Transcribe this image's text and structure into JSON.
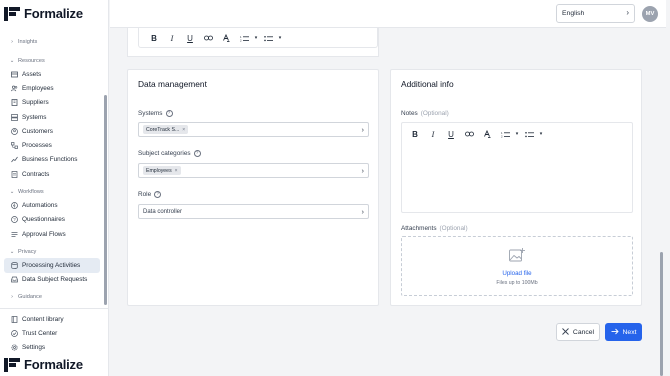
{
  "app": {
    "brand": "Formalize"
  },
  "sidebar": {
    "groups": {
      "insights": "Insights",
      "resources": "Resources",
      "workflows": "Workflows",
      "privacy": "Privacy",
      "guidance": "Guidance"
    },
    "resources": [
      "Assets",
      "Employees",
      "Suppliers",
      "Systems",
      "Customers",
      "Processes",
      "Business Functions",
      "Contracts"
    ],
    "workflows": [
      "Automations",
      "Questionnaires",
      "Approval Flows"
    ],
    "privacy": [
      "Processing Activities",
      "Data Subject Requests"
    ],
    "bottom": [
      "Content library",
      "Trust Center",
      "Settings"
    ],
    "active_item": "Processing Activities"
  },
  "header": {
    "language": "English",
    "avatar_initials": "MV"
  },
  "data_management": {
    "title": "Data management",
    "systems_label": "Systems",
    "systems_chip": "CoreTrack S...",
    "subject_categories_label": "Subject categories",
    "subject_categories_chip": "Employees",
    "role_label": "Role",
    "role_value": "Data controller"
  },
  "additional_info": {
    "title": "Additional info",
    "notes_label": "Notes",
    "optional": "(Optional)",
    "attachments_label": "Attachments",
    "upload_label": "Upload file",
    "upload_hint": "Files up to 100Mb"
  },
  "actions": {
    "cancel": "Cancel",
    "next": "Next"
  },
  "colors": {
    "accent": "#2563eb",
    "active_nav_bg": "#e5ebf3"
  }
}
